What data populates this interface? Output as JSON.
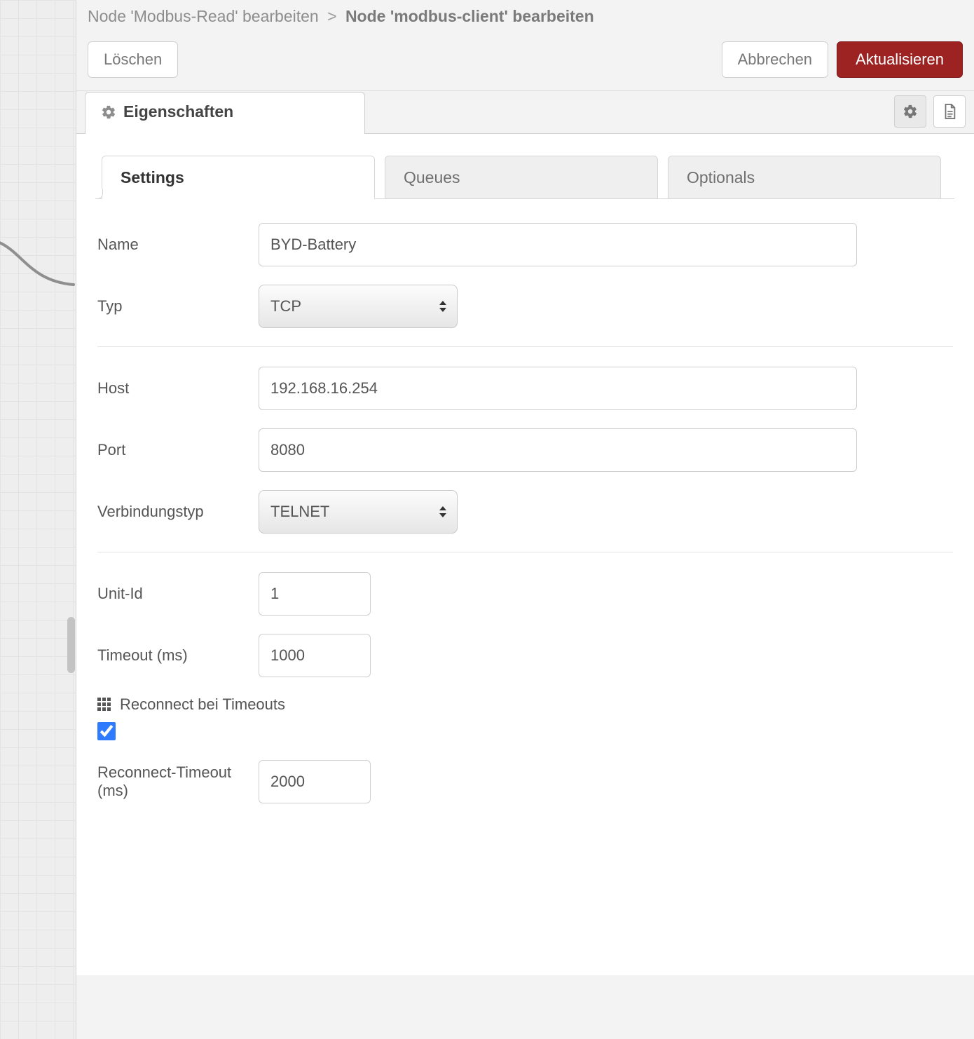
{
  "breadcrumb": {
    "prev": "Node 'Modbus-Read' bearbeiten",
    "sep": ">",
    "current": "Node 'modbus-client' bearbeiten"
  },
  "actions": {
    "delete": "Löschen",
    "cancel": "Abbrechen",
    "update": "Aktualisieren"
  },
  "topTab": {
    "label": "Eigenschaften"
  },
  "subtabs": {
    "settings": "Settings",
    "queues": "Queues",
    "optionals": "Optionals"
  },
  "fields": {
    "name_label": "Name",
    "name_value": "BYD-Battery",
    "type_label": "Typ",
    "type_value": "TCP",
    "host_label": "Host",
    "host_value": "192.168.16.254",
    "port_label": "Port",
    "port_value": "8080",
    "conn_label": "Verbindungstyp",
    "conn_value": "TELNET",
    "unitid_label": "Unit-Id",
    "unitid_value": "1",
    "timeout_label": "Timeout (ms)",
    "timeout_value": "1000",
    "reconnect_header": "Reconnect bei Timeouts",
    "reconnect_checked": true,
    "reconnect_timeout_label": "Reconnect-Timeout (ms)",
    "reconnect_timeout_value": "2000"
  }
}
